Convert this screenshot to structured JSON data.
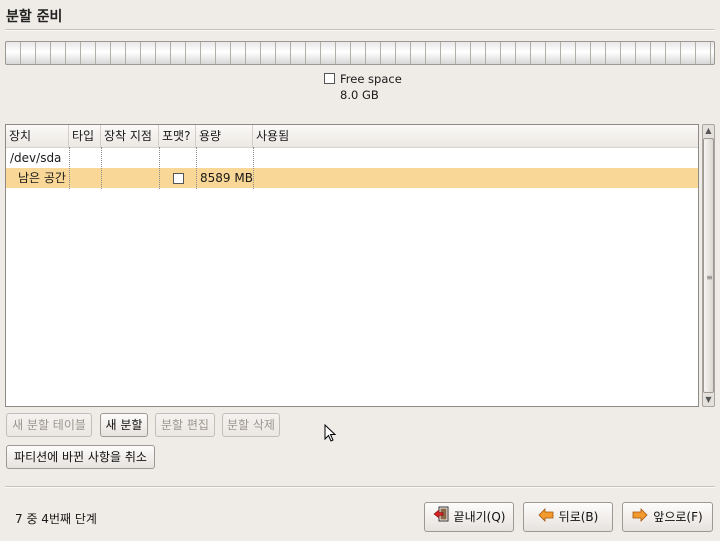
{
  "header": {
    "title": "분할 준비"
  },
  "disk": {
    "legend_label": "Free space",
    "legend_size": "8.0 GB",
    "legend_color": "#ffffff"
  },
  "table": {
    "columns": [
      "장치",
      "타입",
      "장착 지점",
      "포맷?",
      "용량",
      "사용됨"
    ],
    "rows": [
      {
        "device": "/dev/sda",
        "type": "",
        "mount": "",
        "format": null,
        "size": "",
        "used": ""
      },
      {
        "device": "남은 공간",
        "type": "",
        "mount": "",
        "format": false,
        "size": "8589 MB",
        "used": "",
        "selected": true
      }
    ],
    "selection_color": "#f9d796"
  },
  "actions": {
    "new_table": "새 분할 테이블",
    "new": "새 분할",
    "edit": "분할 편집",
    "delete": "분할 삭제",
    "revert": "파티션에 바뀐 사항을 취소"
  },
  "footer": {
    "step": "7 중 4번째 단계",
    "quit": "끝내기(Q)",
    "back": "뒤로(B)",
    "forward": "앞으로(F)"
  }
}
